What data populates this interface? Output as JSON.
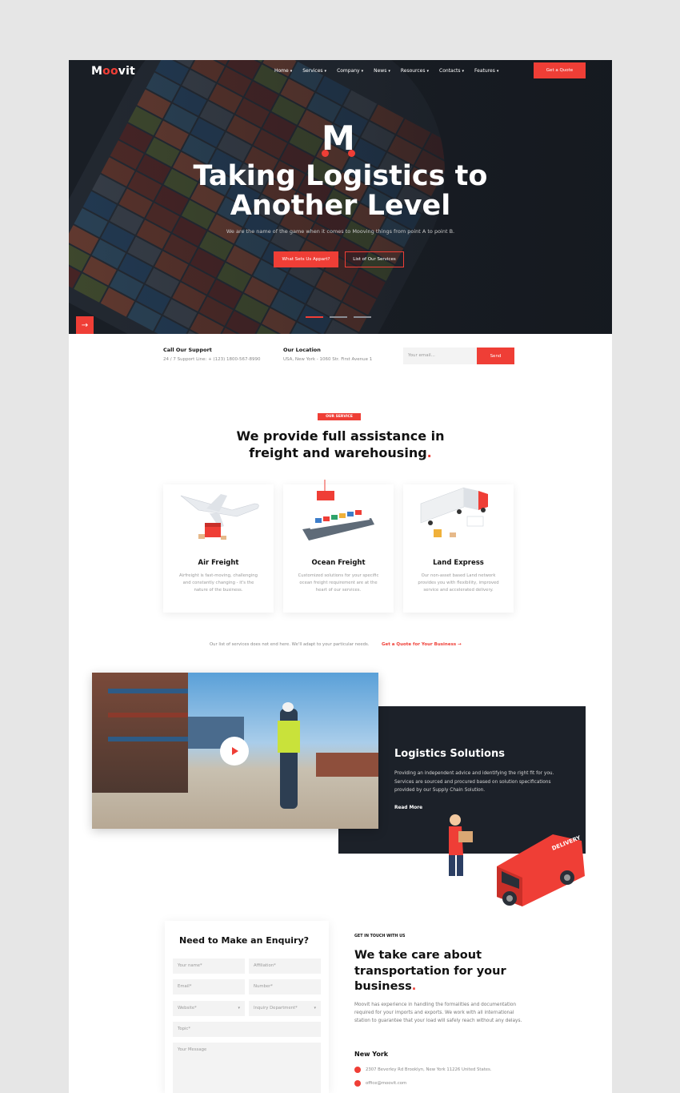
{
  "brand": {
    "logo_pre": "M",
    "logo_oo": "oo",
    "logo_post": "vit"
  },
  "nav": {
    "items": [
      "Home",
      "Services",
      "Company",
      "News",
      "Resources",
      "Contacts",
      "Features"
    ],
    "cta": "Get a Quote"
  },
  "hero": {
    "mark": "M",
    "title_line1": "Taking Logistics to",
    "title_line2": "Another Level",
    "subtitle": "We are the name of the game when it comes to Mooving things from point A to point B.",
    "primary_button": "What Sets Us Appart?",
    "secondary_button": "List of Our Services",
    "arrow": "→"
  },
  "info_bar": {
    "support_title": "Call Our Support",
    "support_text": "24 / 7 Support Line: + (123) 1800-567-8990",
    "location_title": "Our Location",
    "location_text": "USA, New York - 1060 Str. First Avenue 1",
    "email_placeholder": "Your email...",
    "send_label": "Send"
  },
  "services": {
    "tag": "OUR SERVICE",
    "title_line1": "We provide full assistance in",
    "title_line2": "freight and warehousing",
    "title_dot": ".",
    "cards": [
      {
        "title": "Air Freight",
        "text": "Airfreight is fast-moving, challenging and constantly changing - it's the nature of the business."
      },
      {
        "title": "Ocean Freight",
        "text": "Customized solutions for your specific ocean freight requirement are at the heart of our services."
      },
      {
        "title": "Land Express",
        "text": "Our non-asset based Land network provides you with flexibility, improved service and accelerated delivery."
      }
    ],
    "note": "Our list of services does not end here. We'll adapt to your particular needs.",
    "link": "Get a Quote for Your Business →"
  },
  "logistics": {
    "title": "Logistics Solutions",
    "text": "Providing an independent advice and identifying the right fit for you. Services are sourced and procured based on solution specifications provided by our Supply Chain Solution.",
    "read_more": "Read More",
    "van_label": "DELIVERY"
  },
  "enquiry": {
    "title": "Need to Make an Enquiry?",
    "fields": {
      "name": "Your name*",
      "affiliation": "Affiliation*",
      "email": "Email*",
      "number": "Number*",
      "website": "Website*",
      "department": "Inquiry Department*",
      "topic": "Topic*",
      "message": "Your Message"
    }
  },
  "contact": {
    "tag": "GET IN TOUCH WITH US",
    "title_line1": "We take care about",
    "title_line2": "transportation for your",
    "title_line3": "business",
    "title_dot": ".",
    "text": "Moovit has experience in handling the formalities and documentation required for your imports and exports. We work with all international station to guarantee that your load will safely reach without any delays.",
    "city": "New York",
    "address": "2307 Beverley Rd Brooklyn, New York 11226 United States.",
    "email": "office@moovit.com"
  },
  "colors": {
    "accent": "#ef3e36",
    "dark": "#1c2129"
  }
}
